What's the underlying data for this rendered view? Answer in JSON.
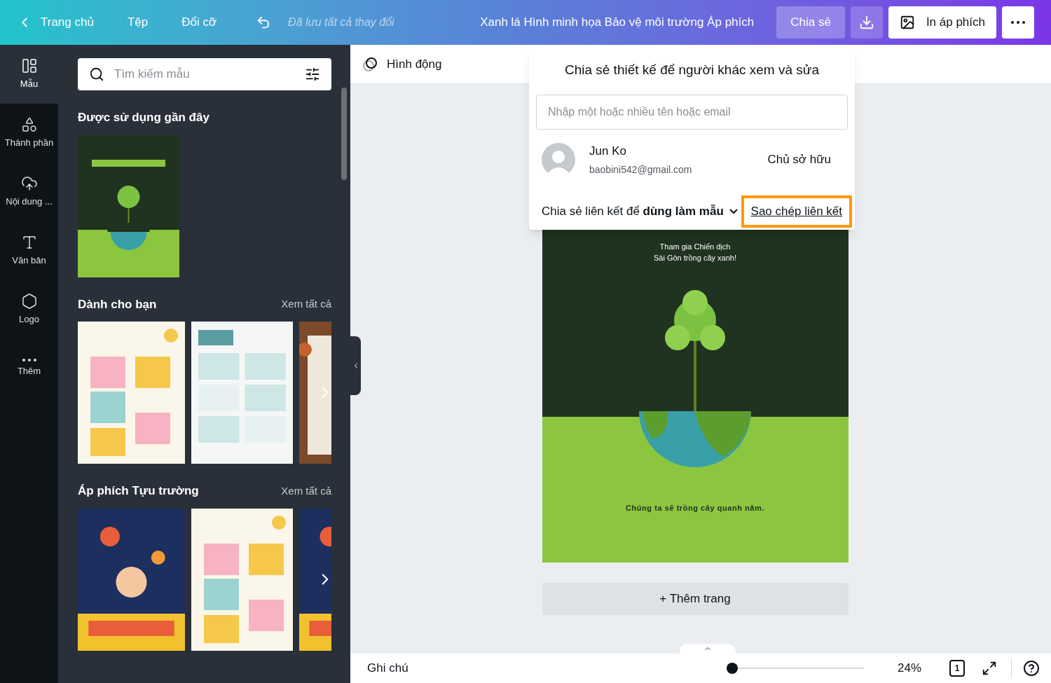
{
  "topbar": {
    "back": "Trang chủ",
    "menus": [
      "Tệp",
      "Đổi cỡ"
    ],
    "save_status": "Đã lưu tất cả thay đổi",
    "title": "Xanh lá Hình minh họa Bảo vệ môi trường Áp phích",
    "share": "Chia sẻ",
    "print": "In áp phích"
  },
  "rail": [
    {
      "kind": "templates",
      "label": "Mẫu",
      "selected": true
    },
    {
      "kind": "elements",
      "label": "Thành phần",
      "selected": false
    },
    {
      "kind": "uploads",
      "label": "Nội dung ...",
      "selected": false
    },
    {
      "kind": "text",
      "label": "Văn bản",
      "selected": false
    },
    {
      "kind": "logo",
      "label": "Logo",
      "selected": false
    },
    {
      "kind": "more",
      "label": "Thêm",
      "selected": false
    }
  ],
  "panel": {
    "search_placeholder": "Tìm kiếm mẫu",
    "sections": [
      {
        "title": "Được sử dụng gần đây",
        "items": [
          {
            "kind": "poster"
          }
        ]
      },
      {
        "title": "Dành cho bạn",
        "see_all": "Xem tất cả",
        "items": [
          {
            "kind": "classroom"
          },
          {
            "kind": "infographic"
          },
          {
            "kind": "wood"
          }
        ]
      },
      {
        "title": "Áp phích Tựu trường",
        "see_all": "Xem tất cả",
        "items": [
          {
            "kind": "space"
          },
          {
            "kind": "classroom"
          },
          {
            "kind": "space"
          }
        ]
      }
    ]
  },
  "toolbar": {
    "animate": "Hình động"
  },
  "share_popup": {
    "heading": "Chia sẻ thiết kế để người khác xem và sửa",
    "placeholder": "Nhập một hoặc nhiều tên hoặc email",
    "member": {
      "name": "Jun Ko",
      "email": "baobini542@gmail.com",
      "role": "Chủ sở hữu"
    },
    "link_setting": "Chia sẻ liên kết để **dùng làm mẫu**",
    "copy_link": "Sao chép liên kết",
    "copy_link_highlighted": true
  },
  "poster": {
    "top_text": [
      "Tham gia Chiến dịch",
      "Sài Gòn trồng cây xanh!"
    ],
    "bottom_text": "Chúng ta sẽ trồng cây quanh năm."
  },
  "add_page": "+ Thêm trang",
  "footer": {
    "notes": "Ghi chú",
    "zoom": {
      "level": 0
    },
    "zoom_reading": "24%",
    "page_count": "1"
  }
}
